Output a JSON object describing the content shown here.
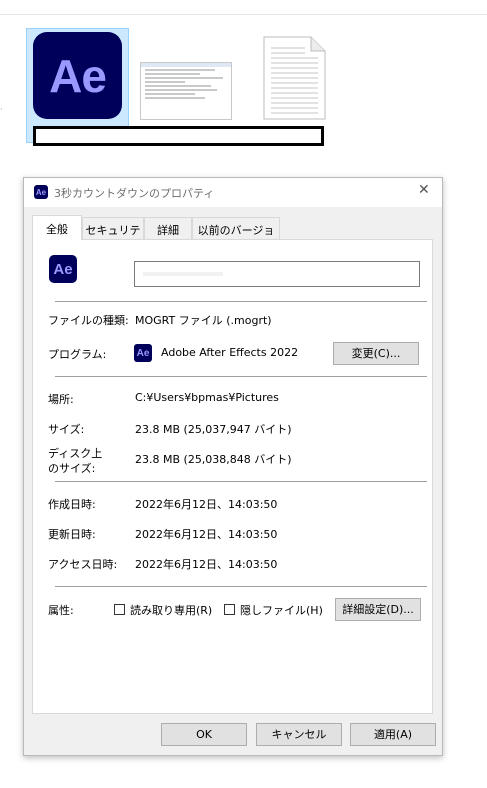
{
  "desktop": {
    "app_icon_text": "Ae"
  },
  "dialog": {
    "title": "3秒カウントダウンのプロパティ",
    "close_glyph": "✕",
    "icon_text": "Ae",
    "tabs": [
      {
        "label": "全般",
        "active": true
      },
      {
        "label": "セキュリティ",
        "active": false
      },
      {
        "label": "詳細",
        "active": false
      },
      {
        "label": "以前のバージョン",
        "active": false
      }
    ],
    "general": {
      "file_name_value": "",
      "file_type_label": "ファイルの種類:",
      "file_type_value": "MOGRT ファイル (.mogrt)",
      "program_label": "プログラム:",
      "program_value": "Adobe After Effects 2022",
      "change_button": "変更(C)...",
      "location_label": "場所:",
      "location_value": "C:¥Users¥bpmas¥Pictures",
      "size_label": "サイズ:",
      "size_value": "23.8 MB (25,037,947 バイト)",
      "disk_size_label_1": "ディスク上",
      "disk_size_label_2": "のサイズ:",
      "disk_size_value": "23.8 MB (25,038,848 バイト)",
      "created_label": "作成日時:",
      "created_value": "2022年6月12日、14:03:50",
      "modified_label": "更新日時:",
      "modified_value": "2022年6月12日、14:03:50",
      "accessed_label": "アクセス日時:",
      "accessed_value": "2022年6月12日、14:03:50",
      "attributes_label": "属性:",
      "readonly_label": "読み取り専用(R)",
      "readonly_checked": false,
      "hidden_label": "隠しファイル(H)",
      "hidden_checked": false,
      "advanced_button": "詳細設定(D)..."
    },
    "buttons": {
      "ok": "OK",
      "cancel": "キャンセル",
      "apply": "適用(A)"
    }
  },
  "colors": {
    "ae_background": "#00005b",
    "ae_letters": "#9999ff",
    "selection": "#cce8ff"
  }
}
